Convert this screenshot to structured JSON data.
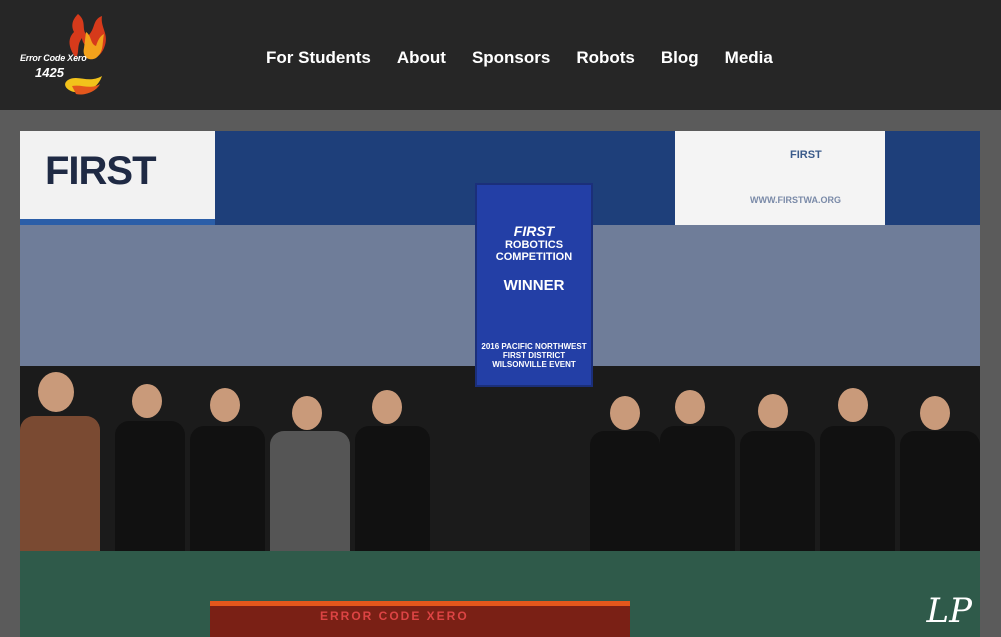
{
  "header": {
    "logo": {
      "line1": "Error Code Xero",
      "line2": "1425",
      "icon": "flame-logo-icon"
    },
    "nav": [
      "For Students",
      "About",
      "Sponsors",
      "Robots",
      "Blog",
      "Media"
    ]
  },
  "hero": {
    "signage": {
      "first_left": "FIRST",
      "first_right": "FIRST",
      "banner_first": "FIRST",
      "banner_competition": "ROBOTICS COMPETITION",
      "banner_winner": "WINNER",
      "banner_event": "2016 PACIFIC NORTHWEST FIRST DISTRICT WILSONVILLE EVENT",
      "website": "WWW.FIRSTWA.ORG",
      "rug": "ERROR CODE XERO",
      "watermark": "LP"
    }
  },
  "colors": {
    "topbar": "#262626",
    "page_bg": "#5b5b5b",
    "nav_text": "#ffffff",
    "banner_blue": "#233fa6"
  }
}
